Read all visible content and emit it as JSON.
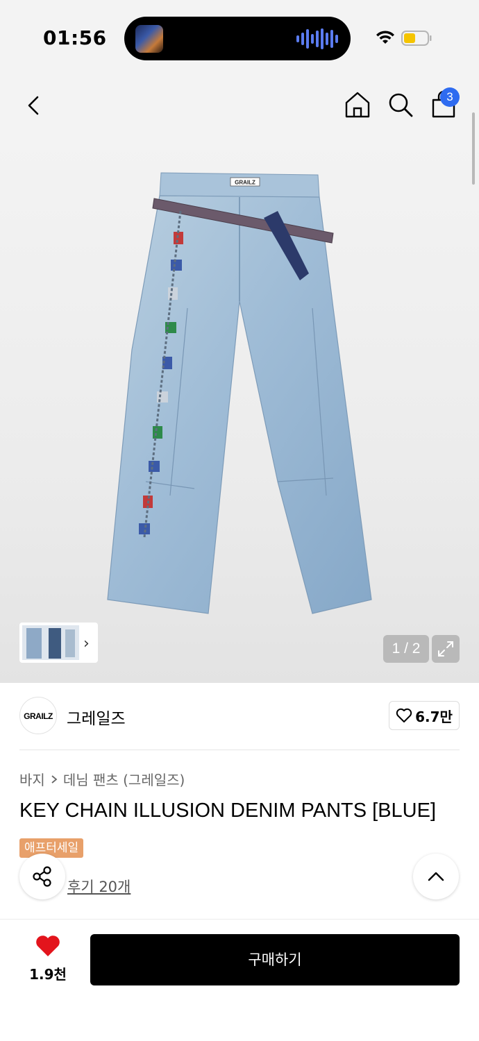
{
  "status_bar": {
    "time": "01:56",
    "wifi_icon": "wifi-icon",
    "battery_icon": "battery-icon",
    "battery_color": "#f5c400"
  },
  "nav": {
    "cart_count": "3",
    "badge_color": "#2e6bf0"
  },
  "gallery": {
    "brand_tag": "GRAILZ",
    "page_counter": "1 / 2"
  },
  "brand": {
    "logo_text": "GRAILZ",
    "name": "그레일즈",
    "like_count": "6.7만"
  },
  "breadcrumb": {
    "category": "바지",
    "subcategory": "데님 팬츠 (그레일즈)"
  },
  "product": {
    "title": "KEY CHAIN ILLUSION DENIM PANTS [BLUE]",
    "sale_badge": "애프터세일",
    "review_link": "후기 20개"
  },
  "bottom_bar": {
    "wish_count": "1.9천",
    "buy_label": "구매하기",
    "heart_color": "#e3141c"
  }
}
